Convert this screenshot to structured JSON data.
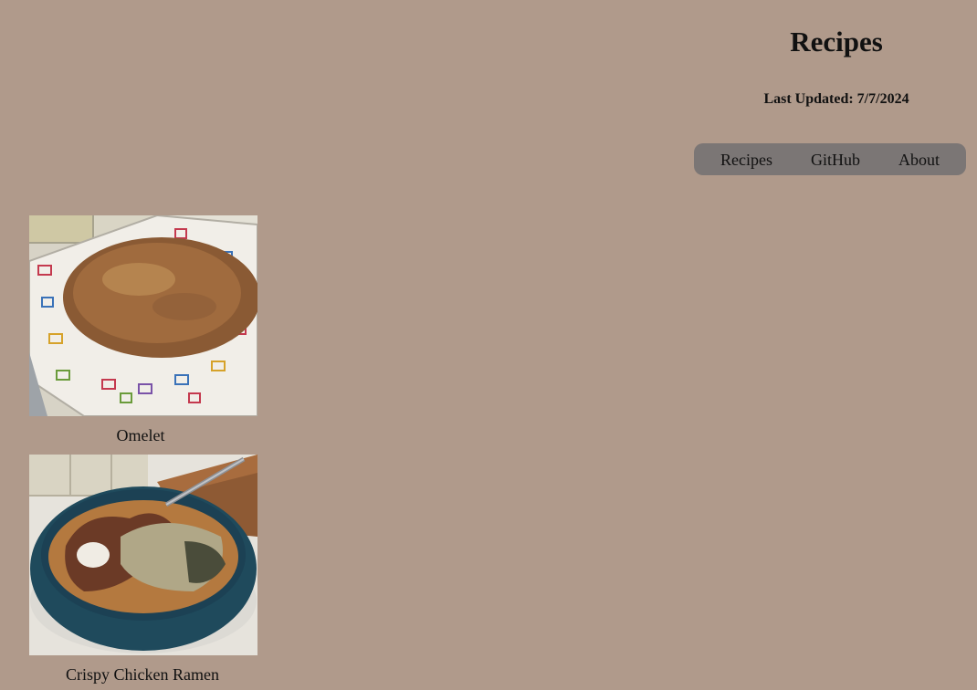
{
  "header": {
    "title": "Recipes",
    "last_updated": "Last Updated: 7/7/2024"
  },
  "nav": {
    "items": [
      {
        "label": "Recipes"
      },
      {
        "label": "GitHub"
      },
      {
        "label": "About"
      }
    ]
  },
  "recipes": [
    {
      "name": "Omelet",
      "image": "omelet-photo"
    },
    {
      "name": "Crispy Chicken Ramen",
      "image": "ramen-photo"
    }
  ],
  "colors": {
    "background": "#b09a8b",
    "nav_background": "#7b7675",
    "text": "#111111"
  }
}
